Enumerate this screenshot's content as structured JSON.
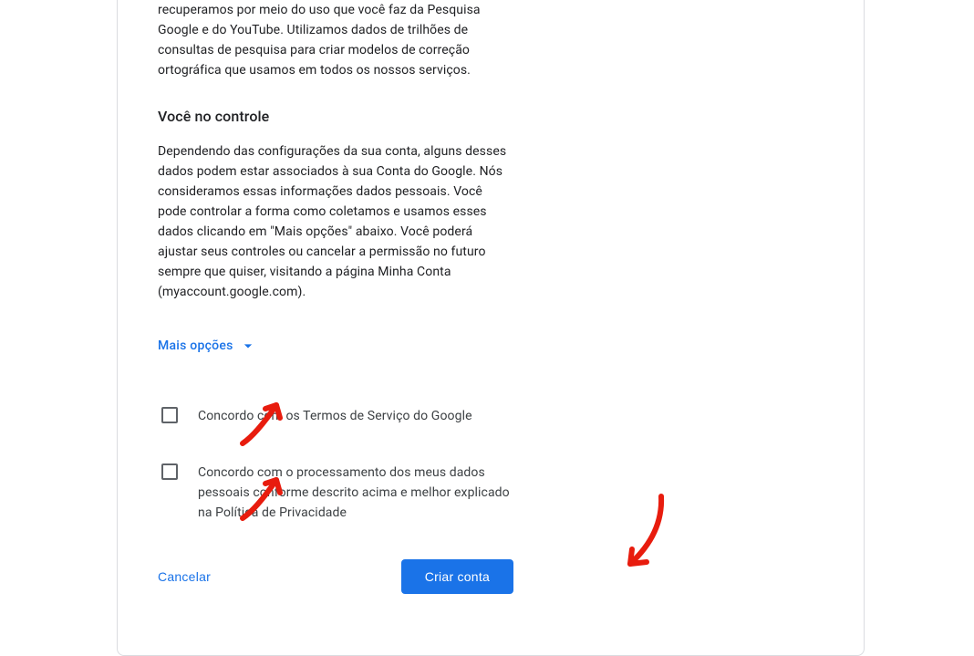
{
  "intro_paragraph": "recuperamos por meio do uso que você faz da Pesquisa Google e do YouTube. Utilizamos dados de trilhões de consultas de pesquisa para criar modelos de correção ortográfica que usamos em todos os nossos serviços.",
  "control_section": {
    "title": "Você no controle",
    "paragraph": "Dependendo das configurações da sua conta, alguns desses dados podem estar associados à sua Conta do Google. Nós consideramos essas informações dados pessoais. Você pode controlar a forma como coletamos e usamos esses dados clicando em \"Mais opções\" abaixo. Você poderá ajustar seus controles ou cancelar a permissão no futuro sempre que quiser, visitando a página Minha Conta (myaccount.google.com)."
  },
  "more_options_label": "Mais opções",
  "checkboxes": {
    "terms": "Concordo com os Termos de Serviço do Google",
    "privacy": "Concordo com o processamento dos meus dados pessoais conforme descrito acima e melhor explicado na Política de Privacidade"
  },
  "buttons": {
    "cancel": "Cancelar",
    "create": "Criar conta"
  }
}
